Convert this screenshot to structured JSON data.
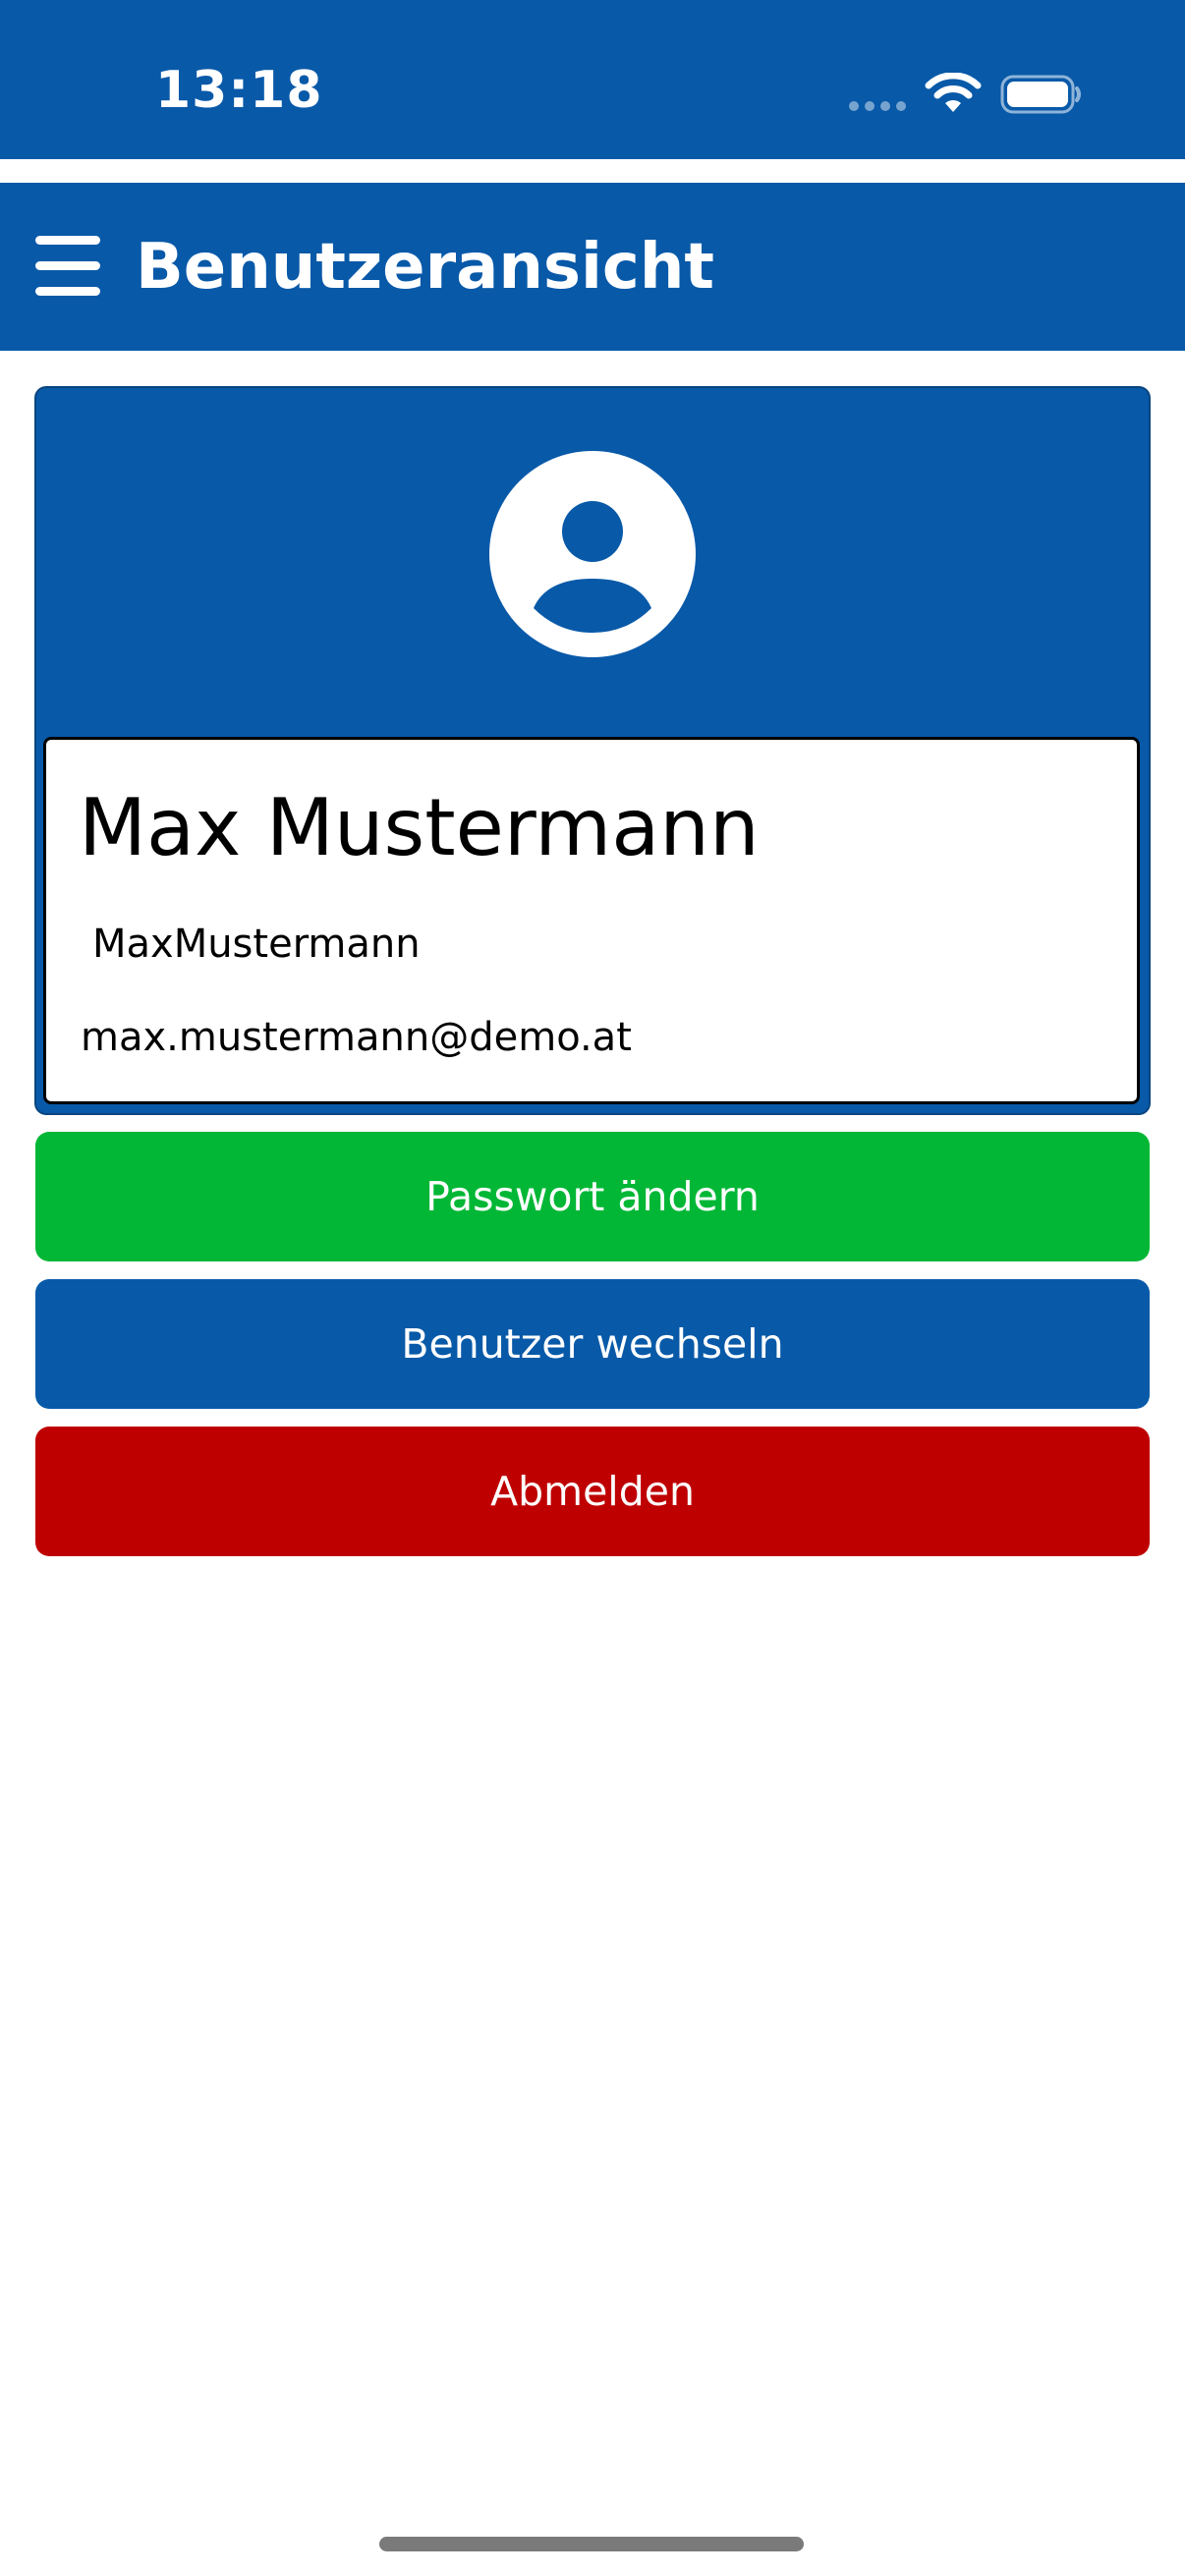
{
  "status_bar": {
    "time": "13:18",
    "icons": [
      "signal-dots-icon",
      "wifi-icon",
      "battery-icon"
    ]
  },
  "header": {
    "title": "Benutzeransicht",
    "menu_icon": "hamburger-menu-icon"
  },
  "user": {
    "avatar_icon": "user-avatar-icon",
    "full_name": "Max Mustermann",
    "username": "MaxMustermann",
    "email": "max.mustermann@demo.at"
  },
  "actions": {
    "change_password": "Passwort ändern",
    "switch_user": "Benutzer wechseln",
    "logout": "Abmelden"
  },
  "colors": {
    "brand_blue": "#0859a8",
    "success_green": "#02b735",
    "danger_red": "#bf0000",
    "white": "#ffffff"
  }
}
